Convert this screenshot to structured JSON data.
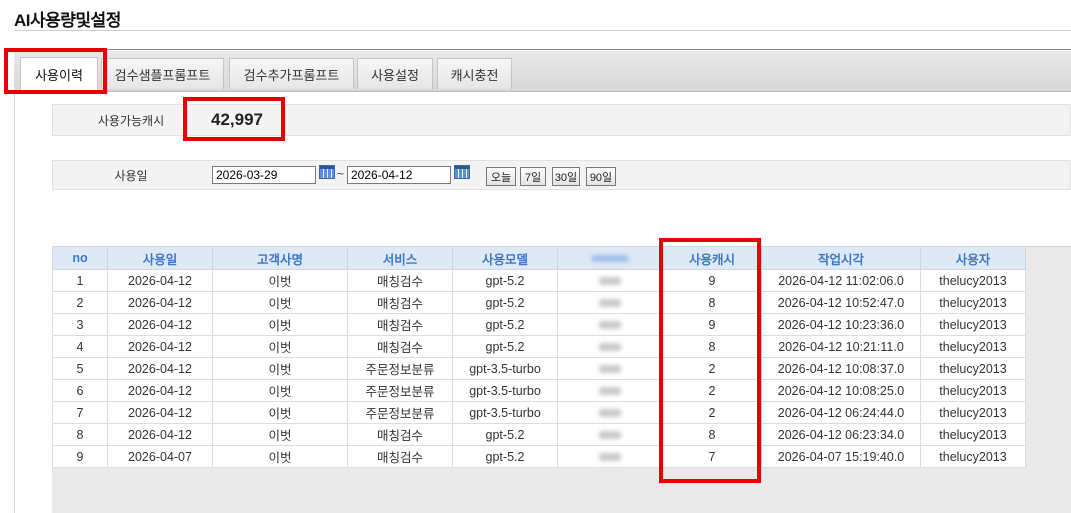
{
  "page": {
    "title": "AI사용량및설정"
  },
  "tabs": [
    {
      "label": "사용이력",
      "active": true
    },
    {
      "label": "검수샘플프롬프트",
      "active": false
    },
    {
      "label": "검수추가프롬프트",
      "active": false
    },
    {
      "label": "사용설정",
      "active": false
    },
    {
      "label": "캐시충전",
      "active": false
    }
  ],
  "cash": {
    "label": "사용가능캐시",
    "value": "42,997"
  },
  "date_filter": {
    "label": "사용일",
    "from": "2026-03-29",
    "separator": "~",
    "to": "2026-04-12",
    "buttons": [
      "오늘",
      "7일",
      "30일",
      "90일"
    ]
  },
  "table": {
    "headers": [
      "no",
      "사용일",
      "고객사명",
      "서비스",
      "사용모델",
      "",
      "사용캐시",
      "작업시각",
      "사용자"
    ],
    "rows": [
      [
        "1",
        "2026-04-12",
        "이벗",
        "매칭검수",
        "gpt-5.2",
        "",
        "9",
        "2026-04-12 11:02:06.0",
        "thelucy2013"
      ],
      [
        "2",
        "2026-04-12",
        "이벗",
        "매칭검수",
        "gpt-5.2",
        "",
        "8",
        "2026-04-12 10:52:47.0",
        "thelucy2013"
      ],
      [
        "3",
        "2026-04-12",
        "이벗",
        "매칭검수",
        "gpt-5.2",
        "",
        "9",
        "2026-04-12 10:23:36.0",
        "thelucy2013"
      ],
      [
        "4",
        "2026-04-12",
        "이벗",
        "매칭검수",
        "gpt-5.2",
        "",
        "8",
        "2026-04-12 10:21:11.0",
        "thelucy2013"
      ],
      [
        "5",
        "2026-04-12",
        "이벗",
        "주문정보분류",
        "gpt-3.5-turbo",
        "",
        "2",
        "2026-04-12 10:08:37.0",
        "thelucy2013"
      ],
      [
        "6",
        "2026-04-12",
        "이벗",
        "주문정보분류",
        "gpt-3.5-turbo",
        "",
        "2",
        "2026-04-12 10:08:25.0",
        "thelucy2013"
      ],
      [
        "7",
        "2026-04-12",
        "이벗",
        "주문정보분류",
        "gpt-3.5-turbo",
        "",
        "2",
        "2026-04-12 06:24:44.0",
        "thelucy2013"
      ],
      [
        "8",
        "2026-04-12",
        "이벗",
        "매칭검수",
        "gpt-5.2",
        "",
        "8",
        "2026-04-12 06:23:34.0",
        "thelucy2013"
      ],
      [
        "9",
        "2026-04-07",
        "이벗",
        "매칭검수",
        "gpt-5.2",
        "",
        "7",
        "2026-04-07 15:19:40.0",
        "thelucy2013"
      ]
    ]
  },
  "colors": {
    "highlight": "#e60000",
    "header_text": "#3a78c8",
    "header_bg": "#dfe9f5"
  }
}
